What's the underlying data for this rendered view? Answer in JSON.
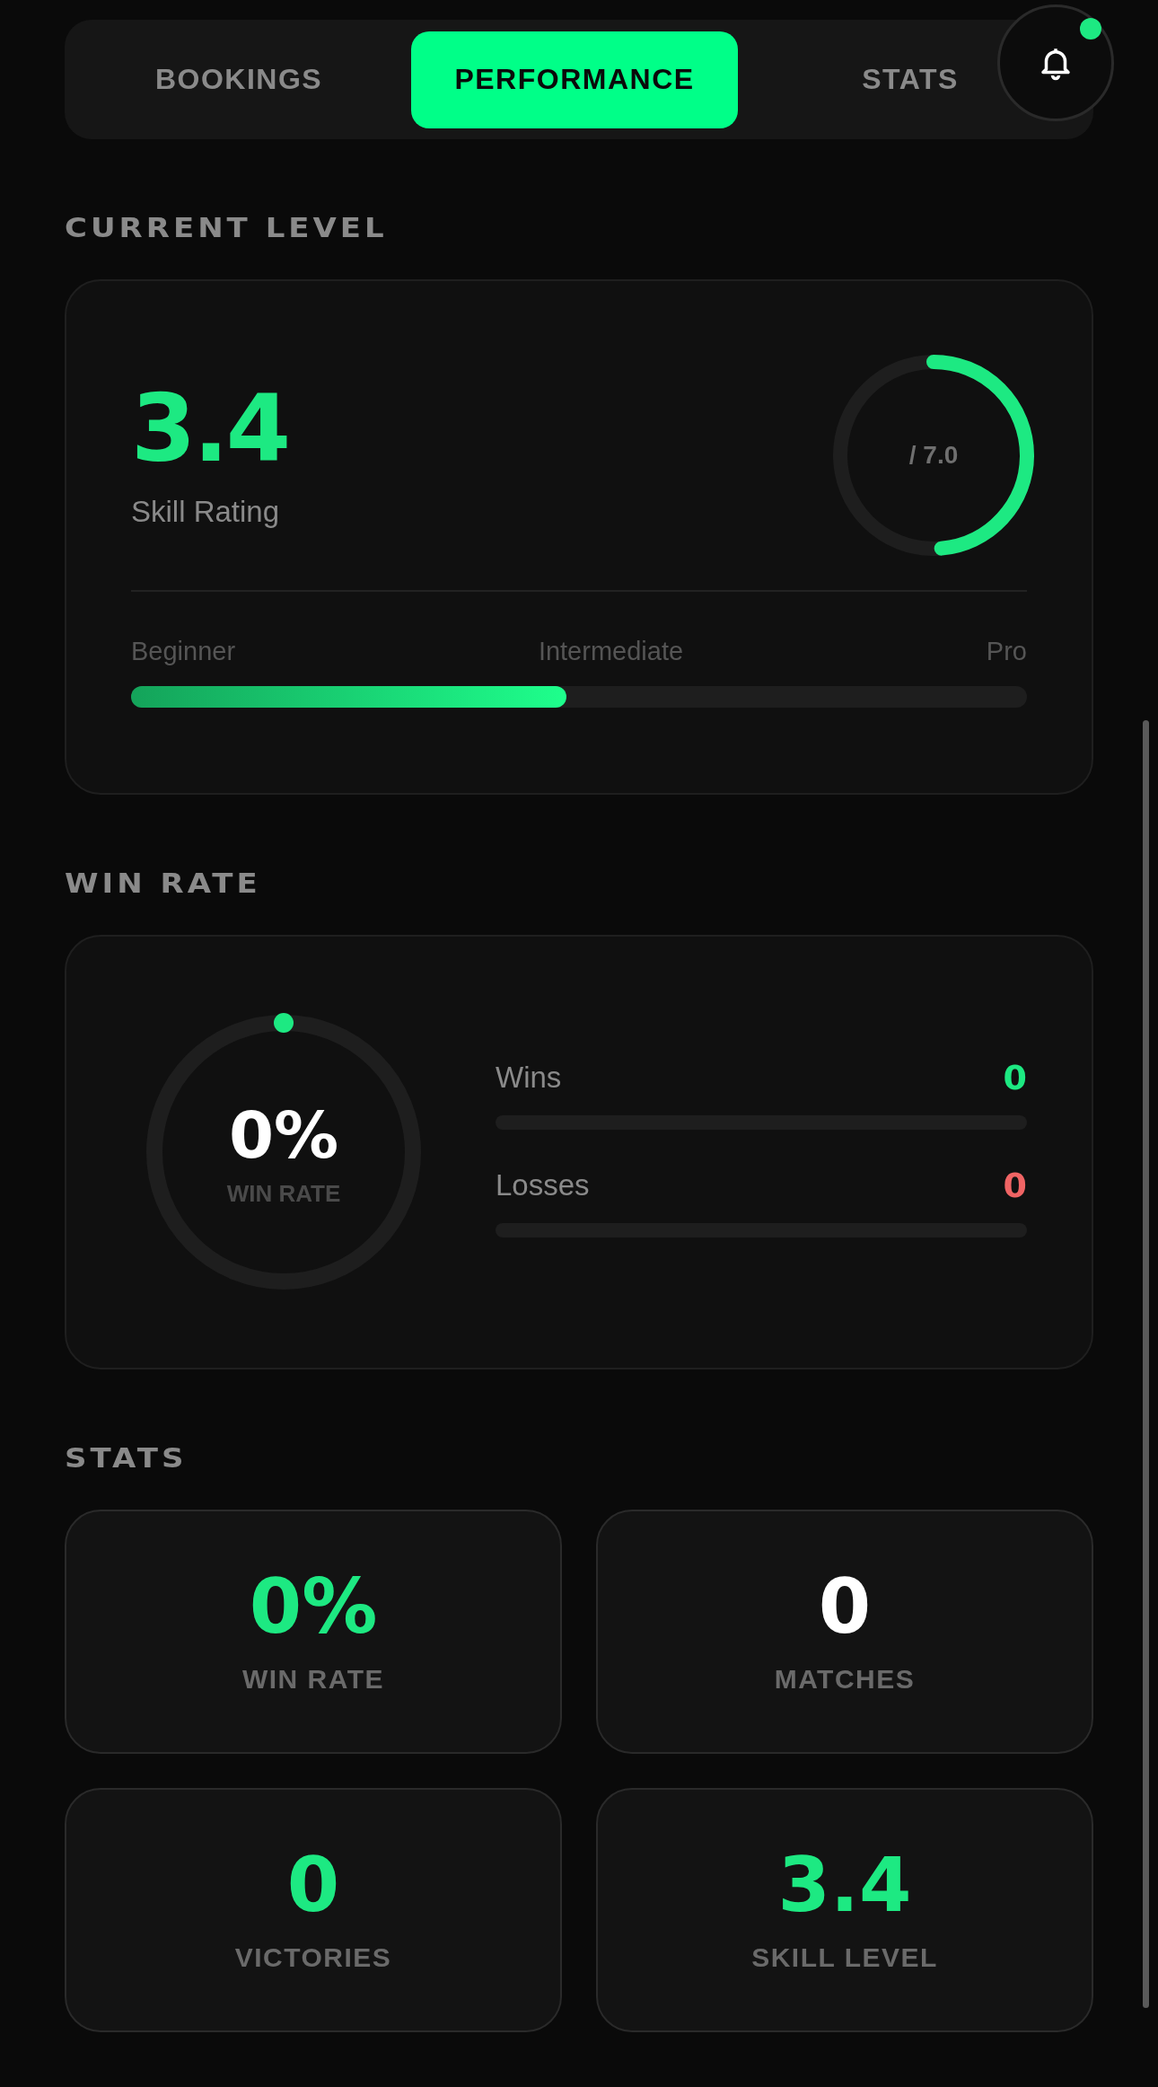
{
  "tabs": [
    {
      "label": "BOOKINGS",
      "selected": false
    },
    {
      "label": "PERFORMANCE",
      "selected": true
    },
    {
      "label": "STATS",
      "selected": false
    }
  ],
  "notifications": {
    "unread": true
  },
  "current_level": {
    "heading": "CURRENT LEVEL",
    "rating": "3.4",
    "rating_label": "Skill Rating",
    "ring": {
      "text": "/ 7.0",
      "level": 0.486
    },
    "scale_labels": [
      "Beginner",
      "Intermediate",
      "Pro"
    ],
    "bar": {
      "level": 0.486
    }
  },
  "win_rate": {
    "heading": "WIN RATE",
    "value": "0%",
    "label": "WIN RATE",
    "ring": {
      "level": 0
    },
    "rows": [
      {
        "name": "Wins",
        "value": "0",
        "level": 0,
        "color": "#1de982"
      },
      {
        "name": "Losses",
        "value": "0",
        "level": 0,
        "color": "#f06464"
      }
    ]
  },
  "stats": {
    "heading": "STATS",
    "cards": [
      {
        "value": "0%",
        "label": "WIN RATE",
        "color": "#1de982"
      },
      {
        "value": "0",
        "label": "MATCHES",
        "color": "#ffffff"
      },
      {
        "value": "0",
        "label": "VICTORIES",
        "color": "#1de982"
      },
      {
        "value": "3.4",
        "label": "SKILL LEVEL",
        "color": "#1de982"
      }
    ]
  }
}
